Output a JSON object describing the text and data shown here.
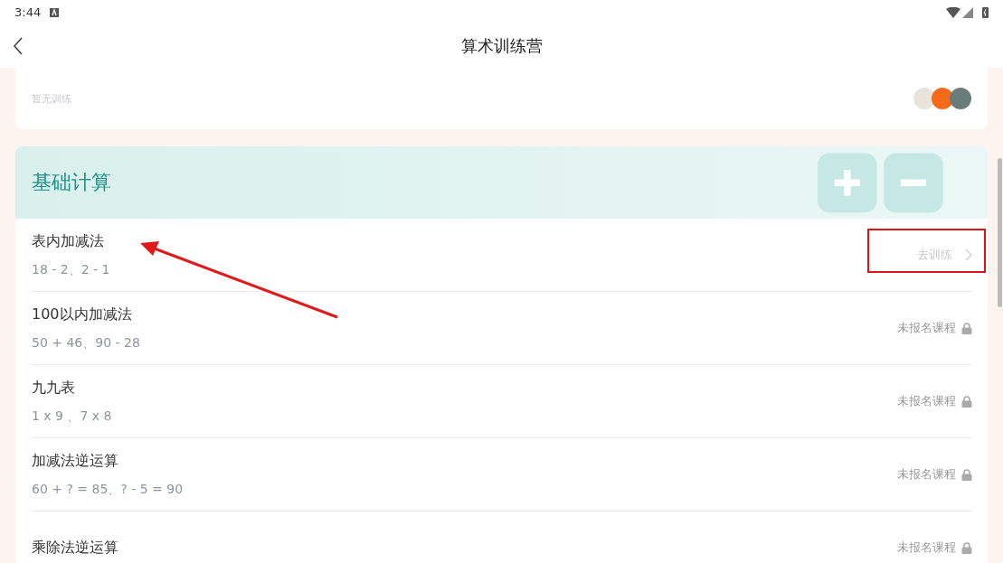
{
  "status_bar": {
    "time": "3:44"
  },
  "header": {
    "title": "算术训练营"
  },
  "summary_card": {
    "empty_text": "暂无训练"
  },
  "section": {
    "title": "基础计算",
    "rows": [
      {
        "title": "表内加减法",
        "example": "18 - 2、2 - 1",
        "kind": "train",
        "action": "去训练"
      },
      {
        "title": "100以内加减法",
        "example": "50 + 46、90 - 28",
        "kind": "locked",
        "action": "未报名课程"
      },
      {
        "title": "九九表",
        "example": "1 x 9 、7 x 8",
        "kind": "locked",
        "action": "未报名课程"
      },
      {
        "title": "加减法逆运算",
        "example": "60 + ? = 85、? - 5 = 90",
        "kind": "locked",
        "action": "未报名课程"
      },
      {
        "title": "乘除法逆运算",
        "kind": "locked",
        "action": "未报名课程"
      }
    ]
  }
}
